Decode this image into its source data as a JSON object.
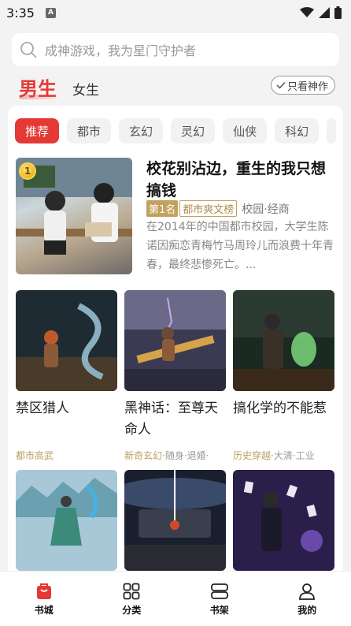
{
  "status": {
    "time": "3:35",
    "app_badge": "A"
  },
  "search": {
    "placeholder": "成神游戏，我为星门守护者"
  },
  "gender_tabs": {
    "male": "男生",
    "female": "女生"
  },
  "only_gods": {
    "label": "只看神作"
  },
  "categories": [
    "推荐",
    "都市",
    "玄幻",
    "灵幻",
    "仙侠",
    "科幻"
  ],
  "featured": {
    "title": "校花别沾边，重生的我只想搞钱",
    "rank_badge": "1",
    "rank_tag": "第1名",
    "list_tag": "都市爽文榜",
    "genre": "校园·经商",
    "description": "在2014年的中国都市校园，大学生陈诺因痴恋青梅竹马周玲儿而浪费十年青春，最终悲惨死亡。..."
  },
  "books": [
    {
      "title": "禁区猎人",
      "meta_highlight": "都市高武",
      "meta_rest": "",
      "colors": [
        "#1e2b33",
        "#4a5b66",
        "#c05a2a"
      ]
    },
    {
      "title": "黑神话：至尊天命人",
      "meta_highlight": "新奇玄幻",
      "meta_rest": "·随身·退婚·",
      "colors": [
        "#3a3a52",
        "#8a6a9a",
        "#d4a34a"
      ]
    },
    {
      "title": "搞化学的不能惹",
      "meta_highlight": "历史穿越",
      "meta_rest": "·大清·工业",
      "colors": [
        "#1a2a22",
        "#3d6e4a",
        "#7ad67a"
      ]
    },
    {
      "title": "",
      "meta_highlight": "",
      "meta_rest": "",
      "colors": [
        "#a8c8d8",
        "#6aa0b0",
        "#3c6e7a"
      ]
    },
    {
      "title": "",
      "meta_highlight": "",
      "meta_rest": "",
      "colors": [
        "#1a1f2e",
        "#3a3f4e",
        "#d04a2a"
      ]
    },
    {
      "title": "",
      "meta_highlight": "",
      "meta_rest": "",
      "colors": [
        "#2a1f4a",
        "#6a4aa8",
        "#c0a8e8"
      ]
    }
  ],
  "bottom_nav": [
    {
      "label": "书城",
      "icon": "bookstore-icon",
      "active": true
    },
    {
      "label": "分类",
      "icon": "category-grid-icon",
      "active": false
    },
    {
      "label": "书架",
      "icon": "bookshelf-icon",
      "active": false
    },
    {
      "label": "我的",
      "icon": "profile-icon",
      "active": false
    }
  ],
  "colors": {
    "accent": "#e53935",
    "gold": "#c2a05e"
  }
}
